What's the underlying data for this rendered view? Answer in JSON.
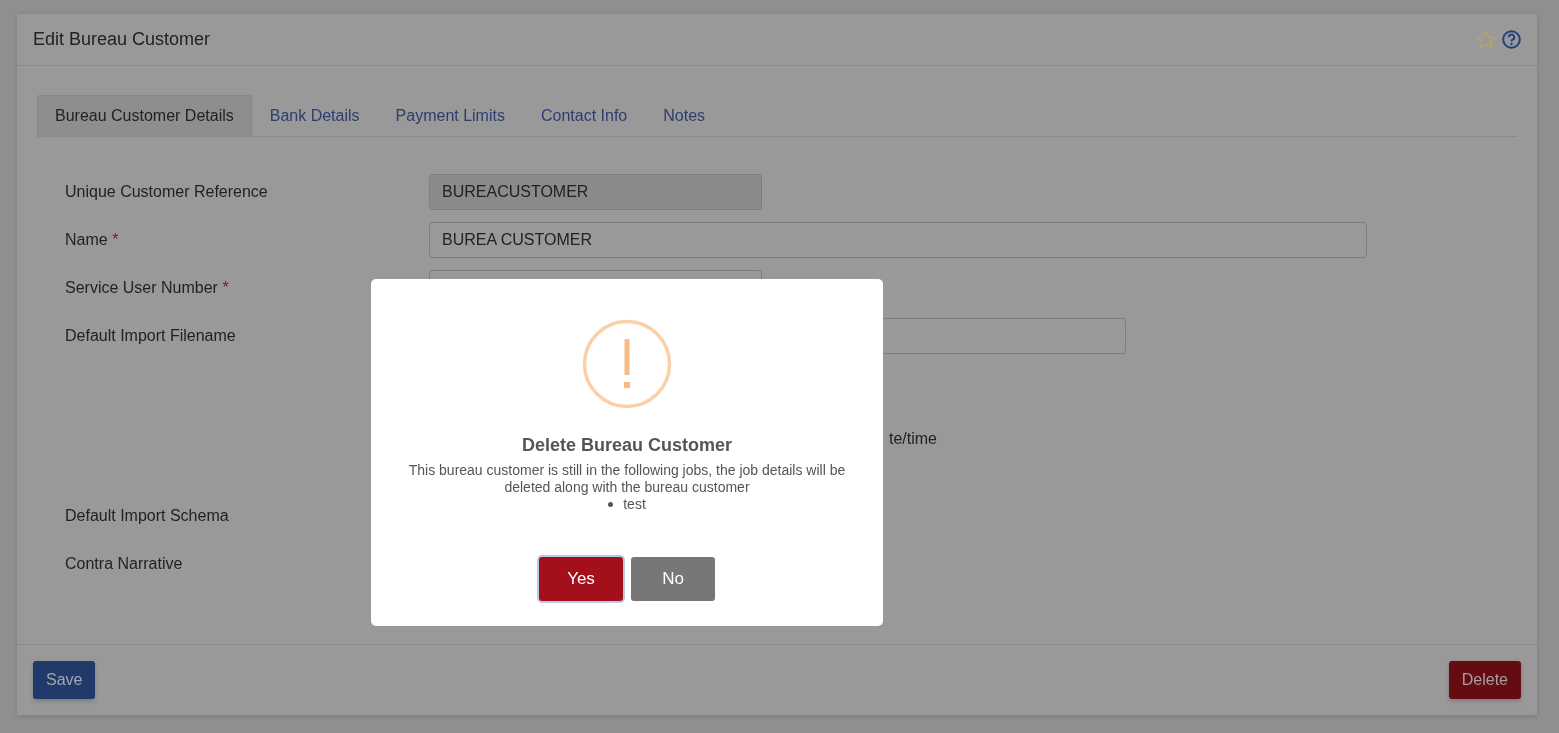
{
  "header": {
    "title": "Edit Bureau Customer"
  },
  "tabs": [
    {
      "label": "Bureau Customer Details",
      "selected": true
    },
    {
      "label": "Bank Details",
      "selected": false
    },
    {
      "label": "Payment Limits",
      "selected": false
    },
    {
      "label": "Contact Info",
      "selected": false
    },
    {
      "label": "Notes",
      "selected": false
    }
  ],
  "form": {
    "fields": [
      {
        "label": "Unique Customer Reference",
        "value": "BUREACUSTOMER",
        "disabled": true
      },
      {
        "label": "Name",
        "required_mark": "*",
        "value": "BUREA CUSTOMER",
        "disabled": false
      },
      {
        "label": "Service User Number",
        "required_mark": "*",
        "disabled": false
      },
      {
        "label": "Default Import Filename",
        "disabled": false
      }
    ],
    "partial_text": "te/time",
    "more_labels": [
      "Default Import Schema",
      "Contra Narrative"
    ]
  },
  "footer": {
    "buttons": [
      {
        "label": "Save",
        "kind": "primary"
      },
      {
        "label": "Delete",
        "kind": "danger"
      }
    ]
  },
  "dialog": {
    "title": "Delete Bureau Customer",
    "message": "This bureau customer is still in the following jobs, the job details will be deleted along with the bureau customer",
    "jobs": [
      "test"
    ],
    "buttons": [
      {
        "label": "Yes",
        "kind": "danger",
        "focused": true
      },
      {
        "label": "No",
        "kind": "secondary",
        "focused": false
      }
    ]
  }
}
